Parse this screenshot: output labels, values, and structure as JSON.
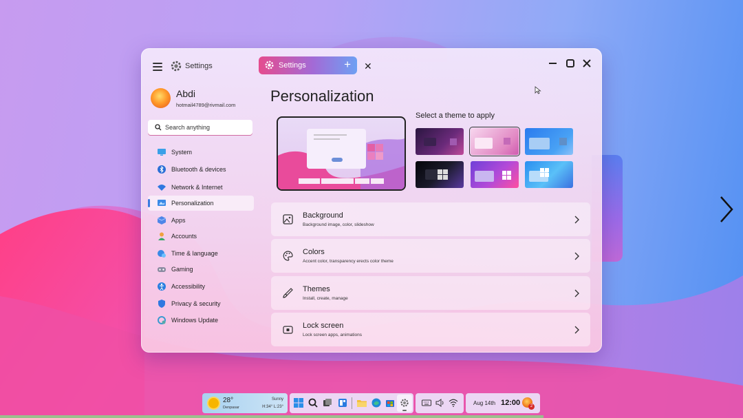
{
  "window": {
    "title": "Settings",
    "tab_label": "Settings",
    "tab_add": "+",
    "tab_close": "✕"
  },
  "profile": {
    "name": "Abdi",
    "email": "hotmail4789@rivmail.com"
  },
  "search": {
    "placeholder": "Search anything"
  },
  "sidebar": {
    "items": [
      {
        "label": "System",
        "icon": "monitor-icon"
      },
      {
        "label": "Bluetooth & devices",
        "icon": "bluetooth-icon"
      },
      {
        "label": "Network & Internet",
        "icon": "wifi-icon"
      },
      {
        "label": "Personalization",
        "icon": "paint-icon",
        "active": true
      },
      {
        "label": "Apps",
        "icon": "apps-icon"
      },
      {
        "label": "Accounts",
        "icon": "person-icon"
      },
      {
        "label": "Time & language",
        "icon": "globe-clock-icon"
      },
      {
        "label": "Gaming",
        "icon": "gamepad-icon"
      },
      {
        "label": "Accessibility",
        "icon": "accessibility-icon"
      },
      {
        "label": "Privacy & security",
        "icon": "shield-icon"
      },
      {
        "label": "Windows Update",
        "icon": "update-icon"
      }
    ]
  },
  "main": {
    "title": "Personalization",
    "theme_prompt": "Select a theme to apply",
    "rows": [
      {
        "title": "Background",
        "subtitle": "Background image, color, slideshow",
        "icon": "image-icon"
      },
      {
        "title": "Colors",
        "subtitle": "Accent color, transparency erects color theme",
        "icon": "palette-icon"
      },
      {
        "title": "Themes",
        "subtitle": "Install, create, manage",
        "icon": "brush-icon"
      },
      {
        "title": "Lock screen",
        "subtitle": "Lock screen apps, animations",
        "icon": "lock-icon"
      }
    ]
  },
  "taskbar": {
    "weather": {
      "temp": "28°",
      "city": "Denpasar",
      "condition": "Sunny",
      "high_low": "H:34° L:23°"
    },
    "date": "Aug 14th",
    "time": "12:00",
    "notification_count": "2"
  },
  "colors": {
    "accent": "#3a7be0",
    "tab_gradient_start": "#e54c8e",
    "tab_gradient_end": "#6ea0f3"
  }
}
